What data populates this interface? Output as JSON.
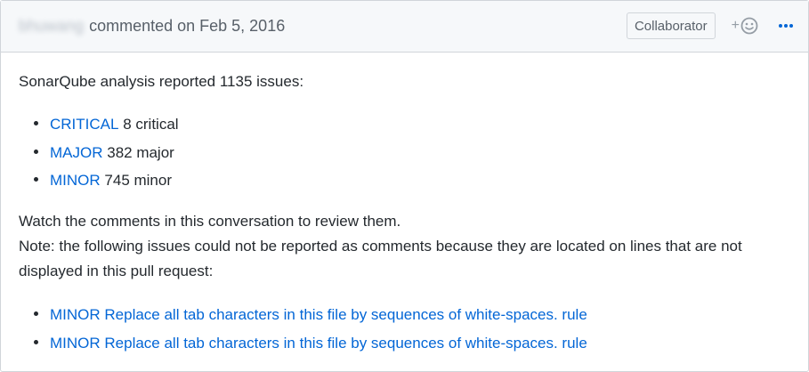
{
  "comment": {
    "author": "bhuwang",
    "header_text": "commented on Feb 5, 2016",
    "role_badge": "Collaborator",
    "reaction_label": "+",
    "icons": {
      "reaction": "smiley-icon",
      "more": "kebab-horizontal-icon"
    },
    "colors": {
      "link": "#0366d6",
      "header_bg": "#f6f8fa",
      "border": "#d1d5da",
      "text": "#24292e",
      "muted": "#586069"
    },
    "intro": "SonarQube analysis reported 1135 issues:",
    "summary": [
      {
        "severity": "CRITICAL",
        "text": "8 critical"
      },
      {
        "severity": "MAJOR",
        "text": "382 major"
      },
      {
        "severity": "MINOR",
        "text": "745 minor"
      }
    ],
    "watch_line": "Watch the comments in this conversation to review them.",
    "note_line": "Note: the following issues could not be reported as comments because they are located on lines that are not displayed in this pull request:",
    "unreported": [
      {
        "link": "MINOR Replace all tab characters in this file by sequences of white-spaces. rule"
      },
      {
        "link": "MINOR Replace all tab characters in this file by sequences of white-spaces. rule"
      }
    ]
  }
}
